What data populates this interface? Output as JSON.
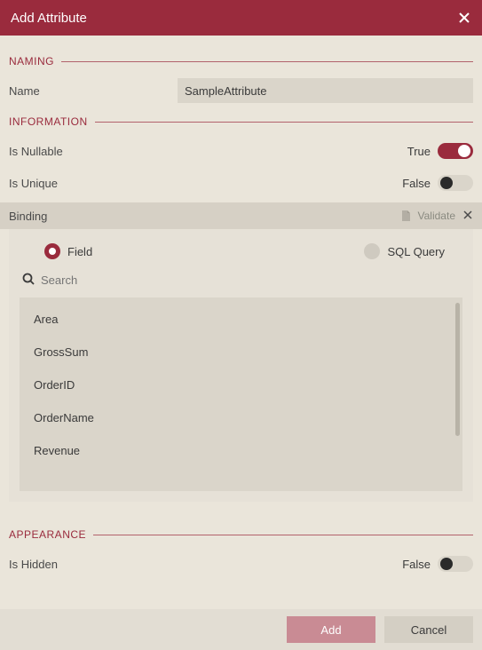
{
  "header": {
    "title": "Add Attribute"
  },
  "sections": {
    "naming": "NAMING",
    "information": "INFORMATION",
    "appearance": "APPEARANCE"
  },
  "naming": {
    "name_label": "Name",
    "name_value": "SampleAttribute"
  },
  "information": {
    "is_nullable_label": "Is Nullable",
    "is_nullable_value": "True",
    "is_unique_label": "Is Unique",
    "is_unique_value": "False"
  },
  "binding": {
    "label": "Binding",
    "validate_label": "Validate",
    "field_label": "Field",
    "sql_label": "SQL Query",
    "search_placeholder": "Search",
    "fields": [
      "Area",
      "GrossSum",
      "OrderID",
      "OrderName",
      "Revenue"
    ]
  },
  "appearance": {
    "is_hidden_label": "Is Hidden",
    "is_hidden_value": "False"
  },
  "footer": {
    "add": "Add",
    "cancel": "Cancel"
  }
}
